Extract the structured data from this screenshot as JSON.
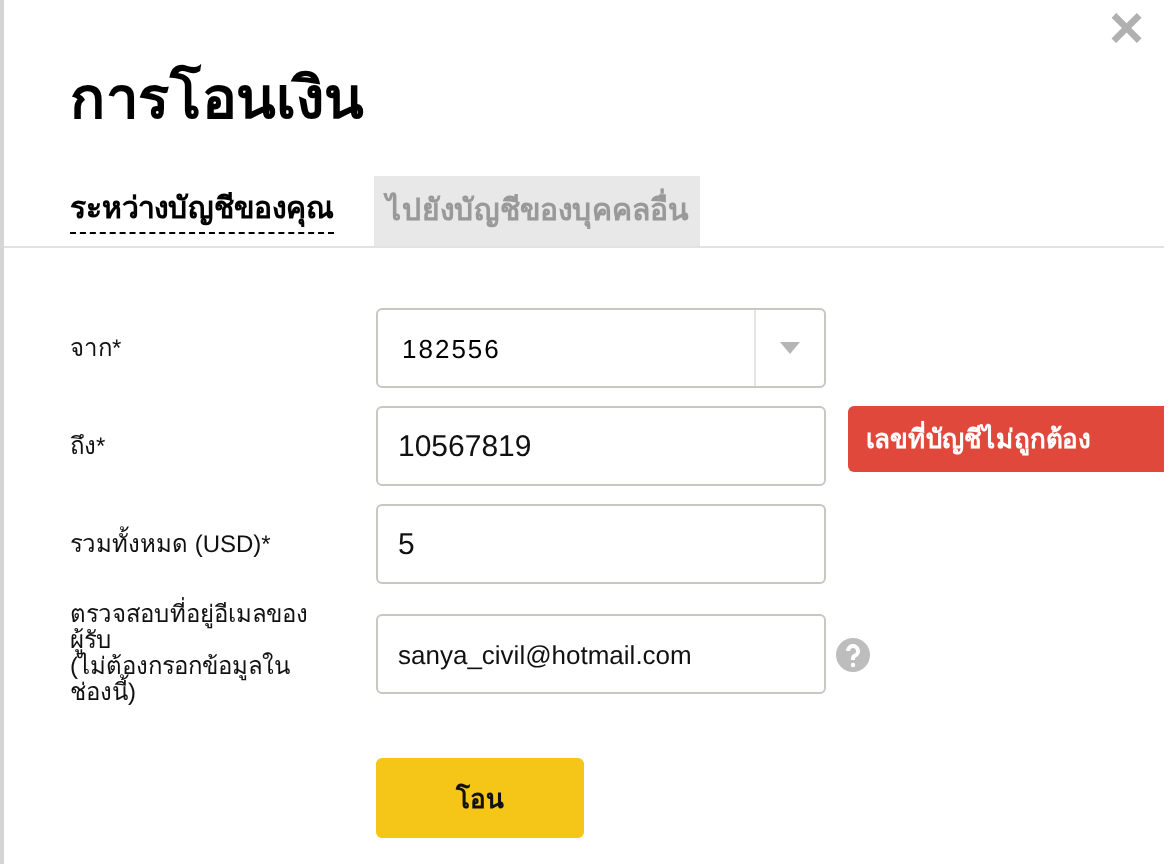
{
  "dialog": {
    "title": "การโอนเงิน",
    "close": "×"
  },
  "tabs": [
    {
      "label": "ระหว่างบัญชีของคุณ",
      "selected": true
    },
    {
      "label": "ไปยังบัญชีของบุคคลอื่น",
      "selected": false
    }
  ],
  "fields": [
    {
      "kind": "select",
      "label": "จาก*",
      "value": "182556"
    },
    {
      "kind": "text",
      "label": "ถึง*",
      "value": "10567819",
      "error": "เลขที่บัญชีไม่ถูกต้อง"
    },
    {
      "kind": "text",
      "label": "รวมทั้งหมด (USD)*",
      "value": "5"
    },
    {
      "kind": "text",
      "label": "ตรวจสอบที่อยู่อีเมลของผู้รับ",
      "note": "(ไม่ต้องกรอกข้อมูลในช่องนี้)",
      "value": "sanya_civil@hotmail.com",
      "help": true
    }
  ],
  "submit": "โอน"
}
